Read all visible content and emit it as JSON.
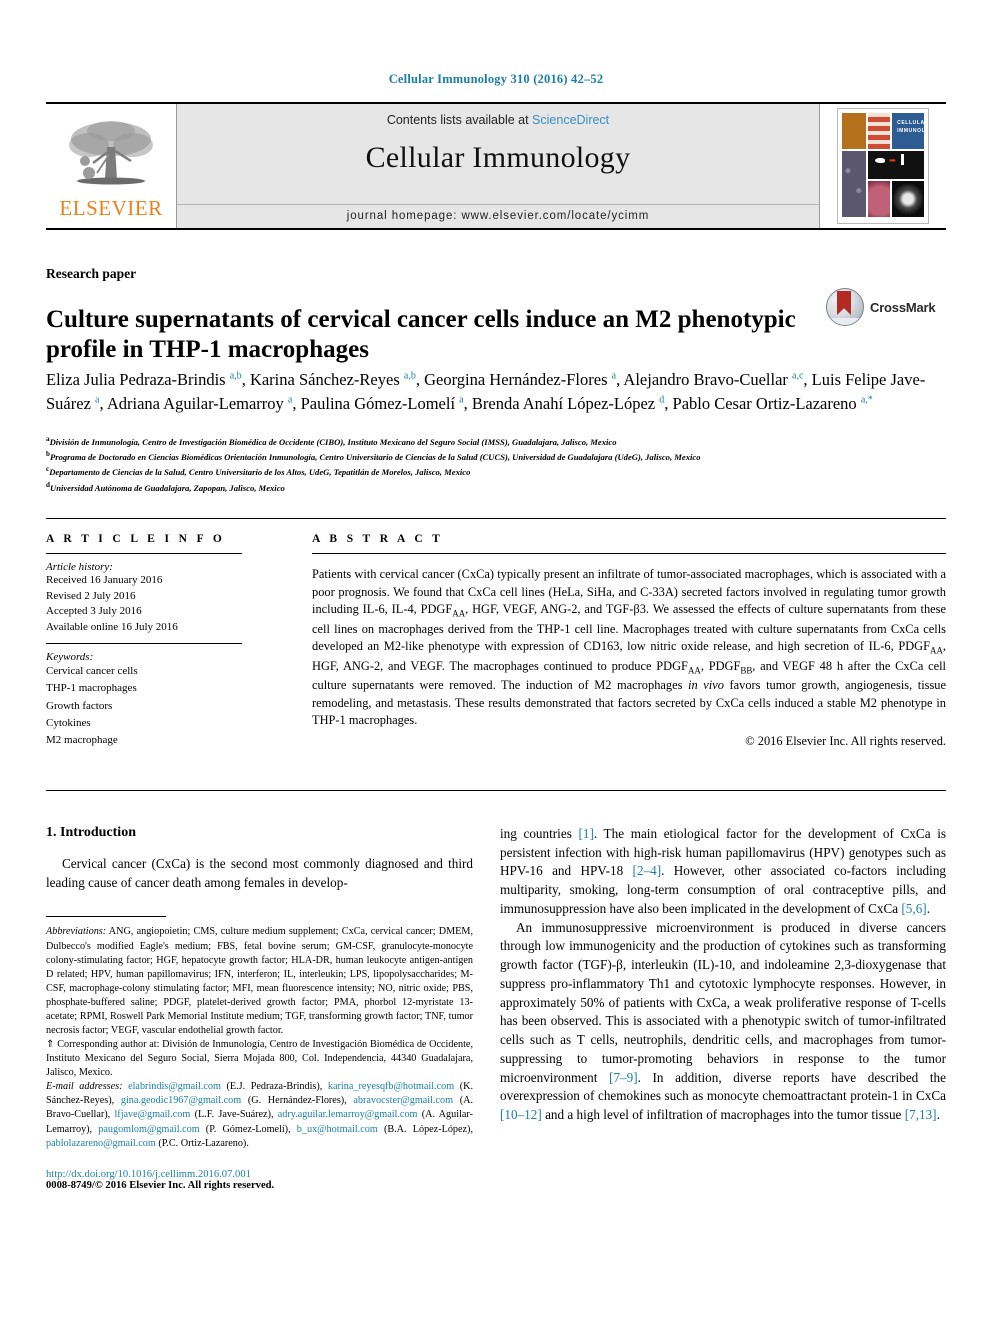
{
  "running_head": "Cellular Immunology 310 (2016) 42–52",
  "masthead": {
    "publisher_name": "ELSEVIER",
    "contents_prefix": "Contents lists available at ",
    "contents_link": "ScienceDirect",
    "journal_name": "Cellular Immunology",
    "homepage": "journal homepage: www.elsevier.com/locate/ycimm",
    "cover_title_line1": "CELLULAR",
    "cover_title_line2": "IMMUNOLOGY"
  },
  "article": {
    "type": "Research paper",
    "title": "Culture supernatants of cervical cancer cells induce an M2 phenotypic profile in THP-1 macrophages",
    "crossmark_label": "CrossMark",
    "authors_html": "Eliza Julia Pedraza-Brindis <sup>a,b</sup>, Karina Sánchez-Reyes <sup>a,b</sup>, Georgina Hernández-Flores <sup>a</sup>, Alejandro Bravo-Cuellar <sup>a,c</sup>, Luis Felipe Jave-Suárez <sup>a</sup>, Adriana Aguilar-Lemarroy <sup>a</sup>, Paulina Gómez-Lomelí <sup>a</sup>, Brenda Anahí López-López <sup>d</sup>, Pablo Cesar Ortiz-Lazareno <sup>a,*</sup>",
    "affiliations": [
      {
        "marker": "a",
        "text": "División de Inmunología, Centro de Investigación Biomédica de Occidente (CIBO), Instituto Mexicano del Seguro Social (IMSS), Guadalajara, Jalisco, Mexico"
      },
      {
        "marker": "b",
        "text": "Programa de Doctorado en Ciencias Biomédicas Orientación Inmunología, Centro Universitario de Ciencias de la Salud (CUCS), Universidad de Guadalajara (UdeG), Jalisco, Mexico"
      },
      {
        "marker": "c",
        "text": "Departamento de Ciencias de la Salud, Centro Universitario de los Altos, UdeG, Tepatitlán de Morelos, Jalisco, Mexico"
      },
      {
        "marker": "d",
        "text": "Universidad Autónoma de Guadalajara, Zapopan, Jalisco, Mexico"
      }
    ]
  },
  "article_info": {
    "heading": "A R T I C L E  I N F O",
    "history_label": "Article history:",
    "history": [
      "Received 16 January 2016",
      "Revised 2 July 2016",
      "Accepted 3 July 2016",
      "Available online 16 July 2016"
    ],
    "keywords_label": "Keywords:",
    "keywords": [
      "Cervical cancer cells",
      "THP-1 macrophages",
      "Growth factors",
      "Cytokines",
      "M2 macrophage"
    ]
  },
  "abstract": {
    "heading": "A B S T R A C T",
    "text_html": "Patients with cervical cancer (CxCa) typically present an infiltrate of tumor-associated macrophages, which is associated with a poor prognosis. We found that CxCa cell lines (HeLa, SiHa, and C-33A) secreted factors involved in regulating tumor growth including IL-6, IL-4, PDGF<sub>AA</sub>, HGF, VEGF, ANG-2, and TGF-β3. We assessed the effects of culture supernatants from these cell lines on macrophages derived from the THP-1 cell line. Macrophages treated with culture supernatants from CxCa cells developed an M2-like phenotype with expression of CD163, low nitric oxide release, and high secretion of IL-6, PDGF<sub>AA</sub>, HGF, ANG-2, and VEGF. The macrophages continued to produce PDGF<sub>AA</sub>, PDGF<sub>BB</sub>, and VEGF 48 h after the CxCa cell culture supernatants were removed. The induction of M2 macrophages <i>in vivo</i> favors tumor growth, angiogenesis, tissue remodeling, and metastasis. These results demonstrated that factors secreted by CxCa cells induced a stable M2 phenotype in THP-1 macrophages.",
    "copyright": "© 2016 Elsevier Inc. All rights reserved."
  },
  "body": {
    "section_heading": "1. Introduction",
    "left_paragraph_html": "Cervical cancer (CxCa) is the second most commonly diagnosed and third leading cause of cancer death among females in develop-",
    "right_paragraphs_html": [
      "ing countries <span class=\"ref\">[1]</span>. The main etiological factor for the development of CxCa is persistent infection with high-risk human papillomavirus (HPV) genotypes such as HPV-16 and HPV-18 <span class=\"ref\">[2–4]</span>. However, other associated co-factors including multiparity, smoking, long-term consumption of oral contraceptive pills, and immunosuppression have also been implicated in the development of CxCa <span class=\"ref\">[5,6]</span>.",
      "An immunosuppressive microenvironment is produced in diverse cancers through low immunogenicity and the production of cytokines such as transforming growth factor (TGF)-β, interleukin (IL)-10, and indoleamine 2,3-dioxygenase that suppress pro-inflammatory Th1 and cytotoxic lymphocyte responses. However, in approximately 50% of patients with CxCa, a weak proliferative response of T-cells has been observed. This is associated with a phenotypic switch of tumor-infiltrated cells such as T cells, neutrophils, dendritic cells, and macrophages from tumor-suppressing to tumor-promoting behaviors in response to the tumor microenvironment <span class=\"ref\">[7–9]</span>. In addition, diverse reports have described the overexpression of chemokines such as monocyte chemoattractant protein-1 in CxCa <span class=\"ref\">[10–12]</span> and a high level of infiltration of macrophages into the tumor tissue <span class=\"ref\">[7,13]</span>."
    ]
  },
  "footnotes": {
    "abbreviations_html": "<i>Abbreviations:</i> ANG, angiopoietin; CMS, culture medium supplement; CxCa, cervical cancer; DMEM, Dulbecco's modified Eagle's medium; FBS, fetal bovine serum; GM-CSF, granulocyte-monocyte colony-stimulating factor; HGF, hepatocyte growth factor; HLA-DR, human leukocyte antigen-antigen D related; HPV, human papillomavirus; IFN, interferon; IL, interleukin; LPS, lipopolysaccharides; M-CSF, macrophage-colony stimulating factor; MFI, mean fluorescence intensity; NO, nitric oxide; PBS, phosphate-buffered saline; PDGF, platelet-derived growth factor; PMA, phorbol 12-myristate 13-acetate; RPMI, Roswell Park Memorial Institute medium; TGF, transforming growth factor; TNF, tumor necrosis factor; VEGF, vascular endothelial growth factor.",
    "corresponding_html": "⇑ Corresponding author at: División de Inmunología, Centro de Investigación Biomédica de Occidente, Instituto Mexicano del Seguro Social, Sierra Mojada 800, Col. Independencia, 44340 Guadalajara, Jalisco, Mexico.",
    "emails_html": "<i>E-mail addresses:</i> <span class=\"mail\">elabrindis@gmail.com</span> (E.J. Pedraza-Brindis), <span class=\"mail\">karina_reyesqfb@hotmail.com</span> (K. Sánchez-Reyes), <span class=\"mail\">gina.geodic1967@gmail.com</span> (G. Hernández-Flores), <span class=\"mail\">abravocster@gmail.com</span> (A. Bravo-Cuellar), <span class=\"mail\">lfjave@gmail.com</span> (L.F. Jave-Suárez), <span class=\"mail\">adry.aguilar.lemarroy@gmail.com</span> (A. Aguilar-Lemarroy), <span class=\"mail\">paugomlom@gmail.com</span> (P. Gómez-Lomelí), <span class=\"mail\">b_ux@hotmail.com</span> (B.A. López-López), <span class=\"mail\">pablolazareno@gmail.com</span> (P.C. Ortiz-Lazareno).",
    "doi": "http://dx.doi.org/10.1016/j.cellimm.2016.07.001",
    "issn_html": "0008-8749/© 2016 Elsevier Inc. All rights reserved."
  },
  "colors": {
    "link_blue": "#1a7fa8",
    "sciencedirect_blue": "#3a8fc4",
    "elsevier_orange": "#ef7f1a",
    "masthead_gray": "#e6e6e6"
  }
}
